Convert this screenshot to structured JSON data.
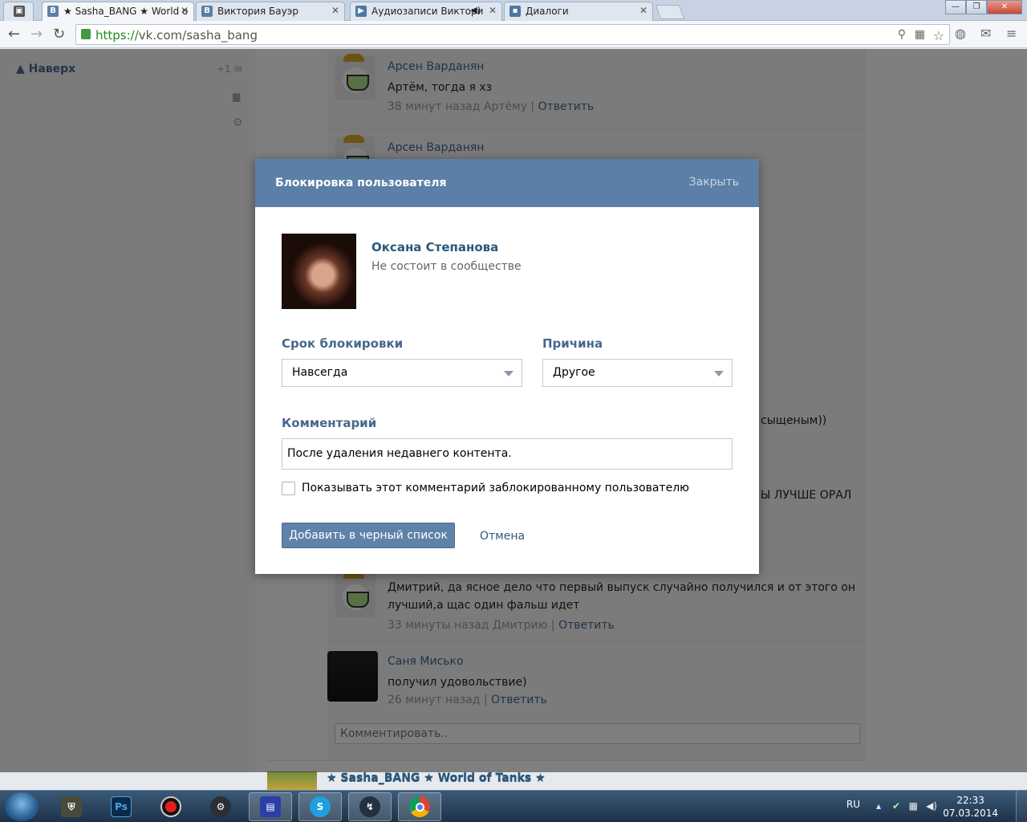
{
  "browser": {
    "tabs": [
      {
        "label": "",
        "icon": "app-icon"
      },
      {
        "label": "★ Sasha_BANG ★ World o",
        "icon": "vk-icon",
        "active": true
      },
      {
        "label": "Виктория Бауэр",
        "icon": "vk-icon"
      },
      {
        "label": "Аудиозаписи Виктори",
        "icon": "audio-icon",
        "has_speaker": true
      },
      {
        "label": "Диалоги",
        "icon": "dialog-icon"
      }
    ],
    "url_scheme": "https://",
    "url_host": "vk.com/",
    "url_path": "sasha_bang"
  },
  "sidebar": {
    "up_label": "Наверх",
    "plus_count": "+1"
  },
  "comments": [
    {
      "author": "Арсен Варданян",
      "text": "Артём, тогда я хз",
      "time": "38 минут назад Артёму",
      "reply": "Ответить"
    },
    {
      "author": "Арсен Варданян",
      "text": "",
      "time": "",
      "reply": ""
    },
    {
      "author": "",
      "text": "Дмитрий, да ясное дело что первый выпуск случайно получился и от этого он лучший,а щас один фальш идет",
      "time": "33 минуты назад Дмитрию",
      "reply": "Ответить"
    },
    {
      "author": "Саня Мисько",
      "text": "получил удовольствие)",
      "time": "26 минут назад",
      "reply": "Ответить"
    }
  ],
  "background_fragments": {
    "fragment_1": "сыщеным))",
    "fragment_2": "Ы ЛУЧШЕ ОРАЛ"
  },
  "comment_input_placeholder": "Комментировать..",
  "post_title": "★ Sasha_BANG ★ World of Tanks ★",
  "modal": {
    "title": "Блокировка пользователя",
    "close_label": "Закрыть",
    "user_name": "Оксана Степанова",
    "user_status": "Не состоит в сообществе",
    "term_label": "Срок блокировки",
    "term_value": "Навсегда",
    "reason_label": "Причина",
    "reason_value": "Другое",
    "comment_label": "Комментарий",
    "comment_value": "После удаления недавнего контента.",
    "show_comment_label": "Показывать этот комментарий заблокированному пользователю",
    "show_comment_checked": false,
    "submit_label": "Добавить в черный список",
    "cancel_label": "Отмена"
  },
  "taskbar": {
    "items": [
      "world-of-tanks",
      "photoshop",
      "recorder",
      "steam",
      "notepad",
      "skype",
      "winamp",
      "chrome"
    ],
    "lang": "RU",
    "time": "22:33",
    "date": "07.03.2014"
  },
  "colors": {
    "vk_header": "#5b7fa6",
    "vk_link": "#2b587a",
    "button": "#5e82a8"
  }
}
